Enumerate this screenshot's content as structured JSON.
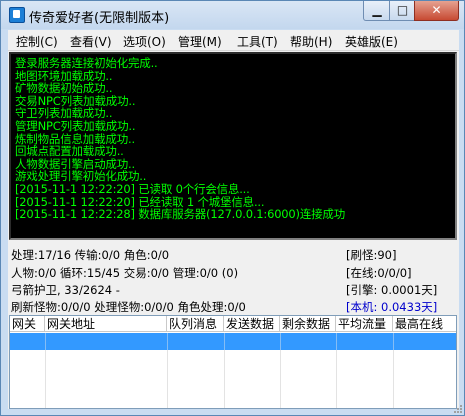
{
  "window": {
    "title": "传奇爱好者(无限制版本)",
    "min_glyph": "▁",
    "max_glyph": "□",
    "close_glyph": "✕"
  },
  "menu": [
    "控制(C)",
    "查看(V)",
    "选项(O)",
    "管理(M)",
    "工具(T)",
    "帮助(H)",
    "英雄版(E)"
  ],
  "log": [
    {
      "text": "登录服务器连接初始化完成..",
      "color": "#00ff00"
    },
    {
      "text": "地图环境加载成功..",
      "color": "#00ff00"
    },
    {
      "text": "矿物数据初始成功..",
      "color": "#00ff00"
    },
    {
      "text": "交易NPC列表加载成功..",
      "color": "#00ff00"
    },
    {
      "text": "守卫列表加载成功..",
      "color": "#00ff00"
    },
    {
      "text": "管理NPC列表加载成功..",
      "color": "#00ff00"
    },
    {
      "text": "炼制物品信息加载成功..",
      "color": "#00ff00"
    },
    {
      "text": "回城点配置加载成功..",
      "color": "#00ff00"
    },
    {
      "text": "人物数据引擎启动成功..",
      "color": "#00ff00"
    },
    {
      "text": "游戏处理引擎初始化成功..",
      "color": "#00ff00"
    },
    {
      "text": "[2015-11-1 12:22:20] 已读取 0个行会信息...",
      "color": "#00ff00"
    },
    {
      "text": "[2015-11-1 12:22:20] 已经读取 1 个城堡信息...",
      "color": "#00ff00"
    },
    {
      "text": "[2015-11-1 12:22:28] 数据库服务器(127.0.0.1:6000)连接成功",
      "color": "#00ff00"
    }
  ],
  "status": {
    "line1": "处理:17/16 传输:0/0 角色:0/0",
    "line2": "人物:0/0 循环:15/45 交易:0/0 管理:0/0 (0)",
    "line3": "弓箭护卫, 33/2624 -",
    "line4": "刷新怪物:0/0/0 处理怪物:0/0/0 角色处理:0/0",
    "refresh_monsters": "[刷怪:90]",
    "online": "[在线:0/0/0]",
    "engine": "[引擎: 0.0001天]",
    "local": "[本机: 0.0433天]",
    "local_color": "#0000cc"
  },
  "table": {
    "columns": [
      "网关",
      "网关地址",
      "队列消息",
      "发送数据",
      "剩余数据",
      "平均流量",
      "最高在线"
    ],
    "selected_row_color": "#3399ff"
  }
}
